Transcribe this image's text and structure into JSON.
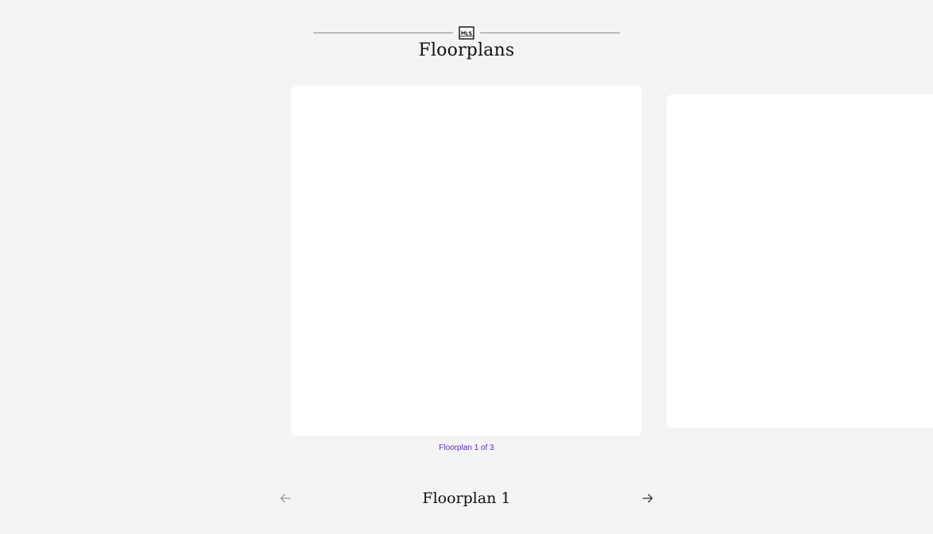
{
  "section": {
    "title": "Floorplans",
    "logo_icon": "mls-logo-icon",
    "rule_color": "#8a8a8a"
  },
  "carousel": {
    "counter": "Floorplan 1 of 3",
    "counter_color": "#5b2bbf",
    "current_title": "Floorplan 1",
    "prev_icon": "arrow-left-icon",
    "next_icon": "arrow-right-icon"
  }
}
